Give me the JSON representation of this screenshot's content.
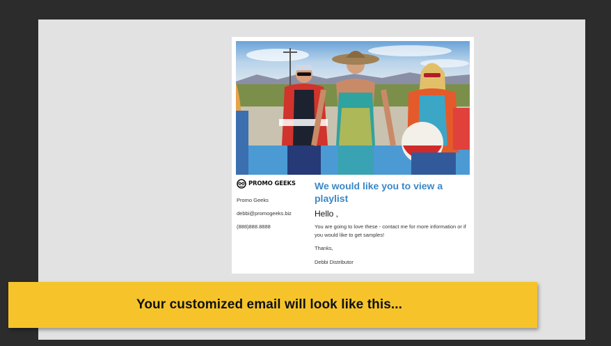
{
  "email": {
    "hero_image": "group-of-people-in-colorful-outfits-photo",
    "logo_text": "PROMO GEEKS",
    "logo_icon": "promo-geeks-logo-icon",
    "company_name": "Promo Geeks",
    "email_address": "debbi@promogeeks.biz",
    "phone": "(888)888.8888",
    "title": "We would like you to view a playlist",
    "greeting": "Hello ,",
    "body": "You are going to love these - contact me for more information or if you would like to get samples!",
    "thanks": "Thanks,",
    "signature": "Debbi Distributor",
    "title_color": "#3a87c8"
  },
  "banner": {
    "text": "Your customized email will look like this...",
    "color": "#f6c42a"
  }
}
